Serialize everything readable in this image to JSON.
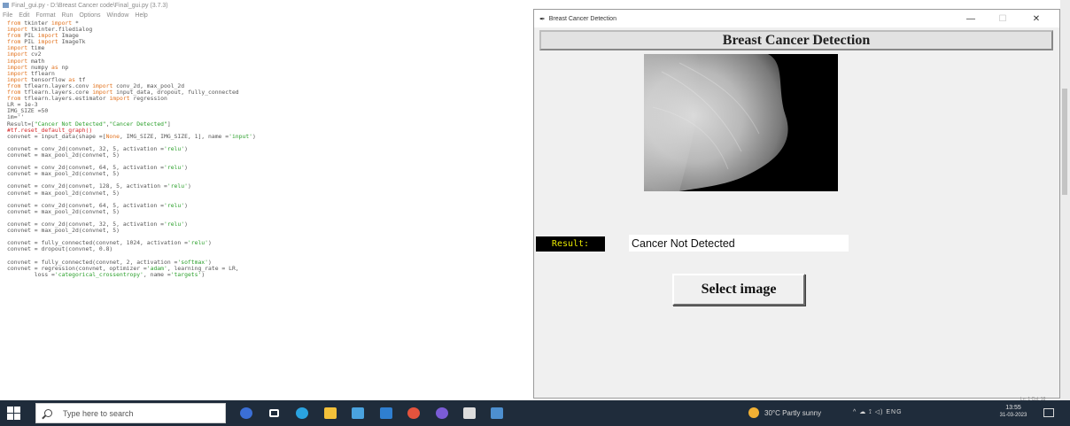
{
  "editor": {
    "title": "Final_gui.py - D:\\Breast Cancer code\\Final_gui.py (3.7.3)",
    "menu": [
      "File",
      "Edit",
      "Format",
      "Run",
      "Options",
      "Window",
      "Help"
    ],
    "code_lines": [
      [
        [
          "kw",
          "from "
        ],
        [
          "t",
          "tkinter "
        ],
        [
          "kw",
          "import "
        ],
        [
          "t",
          "*"
        ]
      ],
      [
        [
          "kw",
          "import "
        ],
        [
          "t",
          "tkinter.filedialog"
        ]
      ],
      [
        [
          "kw",
          "from "
        ],
        [
          "t",
          "PIL "
        ],
        [
          "kw",
          "import "
        ],
        [
          "t",
          "Image"
        ]
      ],
      [
        [
          "kw",
          "from "
        ],
        [
          "t",
          "PIL "
        ],
        [
          "kw",
          "import "
        ],
        [
          "t",
          "ImageTk"
        ]
      ],
      [
        [
          "kw",
          "import "
        ],
        [
          "t",
          "time"
        ]
      ],
      [
        [
          "kw",
          "import "
        ],
        [
          "t",
          "cv2"
        ]
      ],
      [
        [
          "kw",
          "import "
        ],
        [
          "t",
          "math"
        ]
      ],
      [
        [
          "kw",
          "import "
        ],
        [
          "t",
          "numpy "
        ],
        [
          "kw",
          "as "
        ],
        [
          "t",
          "np"
        ]
      ],
      [
        [
          "kw",
          "import "
        ],
        [
          "t",
          "tflearn"
        ]
      ],
      [
        [
          "kw",
          "import "
        ],
        [
          "t",
          "tensorflow "
        ],
        [
          "kw",
          "as "
        ],
        [
          "t",
          "tf"
        ]
      ],
      [
        [
          "kw",
          "from "
        ],
        [
          "t",
          "tflearn.layers.conv "
        ],
        [
          "kw",
          "import "
        ],
        [
          "t",
          "conv_2d, max_pool_2d"
        ]
      ],
      [
        [
          "kw",
          "from "
        ],
        [
          "t",
          "tflearn.layers.core "
        ],
        [
          "kw",
          "import "
        ],
        [
          "t",
          "input_data, dropout, fully_connected"
        ]
      ],
      [
        [
          "kw",
          "from "
        ],
        [
          "t",
          "tflearn.layers.estimator "
        ],
        [
          "kw",
          "import "
        ],
        [
          "t",
          "regression"
        ]
      ],
      [
        [
          "t",
          "LR = 1e-3"
        ]
      ],
      [
        [
          "t",
          "IMG_SIZE =50"
        ]
      ],
      [
        [
          "t",
          "im=''"
        ]
      ],
      [
        [
          "t",
          "Result=["
        ],
        [
          "str",
          "\"Cancer Not Detected\""
        ],
        [
          "t",
          ","
        ],
        [
          "str",
          "\"Cancer Detected\""
        ],
        [
          "t",
          "]"
        ]
      ],
      [
        [
          "cmt",
          "#tf.reset_default_graph()"
        ]
      ],
      [
        [
          "t",
          "convnet = input_data(shape =["
        ],
        [
          "kw",
          "None"
        ],
        [
          "t",
          ", IMG_SIZE, IMG_SIZE, 1], name ="
        ],
        [
          "str",
          "'input'"
        ],
        [
          "t",
          ")"
        ]
      ],
      [],
      [
        [
          "t",
          "convnet = conv_2d(convnet, 32, 5, activation ="
        ],
        [
          "str",
          "'relu'"
        ],
        [
          "t",
          ")"
        ]
      ],
      [
        [
          "t",
          "convnet = max_pool_2d(convnet, 5)"
        ]
      ],
      [],
      [
        [
          "t",
          "convnet = conv_2d(convnet, 64, 5, activation ="
        ],
        [
          "str",
          "'relu'"
        ],
        [
          "t",
          ")"
        ]
      ],
      [
        [
          "t",
          "convnet = max_pool_2d(convnet, 5)"
        ]
      ],
      [],
      [
        [
          "t",
          "convnet = conv_2d(convnet, 128, 5, activation ="
        ],
        [
          "str",
          "'relu'"
        ],
        [
          "t",
          ")"
        ]
      ],
      [
        [
          "t",
          "convnet = max_pool_2d(convnet, 5)"
        ]
      ],
      [],
      [
        [
          "t",
          "convnet = conv_2d(convnet, 64, 5, activation ="
        ],
        [
          "str",
          "'relu'"
        ],
        [
          "t",
          ")"
        ]
      ],
      [
        [
          "t",
          "convnet = max_pool_2d(convnet, 5)"
        ]
      ],
      [],
      [
        [
          "t",
          "convnet = conv_2d(convnet, 32, 5, activation ="
        ],
        [
          "str",
          "'relu'"
        ],
        [
          "t",
          ")"
        ]
      ],
      [
        [
          "t",
          "convnet = max_pool_2d(convnet, 5)"
        ]
      ],
      [],
      [
        [
          "t",
          "convnet = fully_connected(convnet, 1024, activation ="
        ],
        [
          "str",
          "'relu'"
        ],
        [
          "t",
          ")"
        ]
      ],
      [
        [
          "t",
          "convnet = dropout(convnet, 0.8)"
        ]
      ],
      [],
      [
        [
          "t",
          "convnet = fully_connected(convnet, 2, activation ="
        ],
        [
          "str",
          "'softmax'"
        ],
        [
          "t",
          ")"
        ]
      ],
      [
        [
          "t",
          "convnet = regression(convnet, optimizer ="
        ],
        [
          "str",
          "'adam'"
        ],
        [
          "t",
          ", learning_rate = LR,"
        ]
      ],
      [
        [
          "t",
          "        loss ="
        ],
        [
          "str",
          "'categorical_crossentropy'"
        ],
        [
          "t",
          ", name ="
        ],
        [
          "str",
          "'targets'"
        ],
        [
          "t",
          ")"
        ]
      ]
    ],
    "status": "Ln: 1  Col: 18"
  },
  "app": {
    "window_title": "Breast Cancer Detection",
    "heading": "Breast Cancer Detection",
    "result_label": "Result:",
    "result_value": "Cancer Not Detected",
    "select_button": "Select image",
    "window_controls": {
      "minimize": "—",
      "maximize": "☐",
      "close": "✕"
    }
  },
  "taskbar": {
    "search_placeholder": "Type here to search",
    "apps": [
      {
        "name": "cortana",
        "color": "#3b6fd6"
      },
      {
        "name": "task-view",
        "color": "#ffffff"
      },
      {
        "name": "edge",
        "color": "#2aa3e0"
      },
      {
        "name": "file-explorer",
        "color": "#f3c13a"
      },
      {
        "name": "store",
        "color": "#4aa3df"
      },
      {
        "name": "mail",
        "color": "#2f7fd1"
      },
      {
        "name": "chrome",
        "color": "#e5533d"
      },
      {
        "name": "browser",
        "color": "#7b5cd6"
      },
      {
        "name": "settings",
        "color": "#dddddd"
      },
      {
        "name": "python-idle",
        "color": "#4d8fcf"
      }
    ],
    "weather": "30°C  Partly sunny",
    "tray": "^  ☁  ⟟  ◁)  ENG",
    "language": "",
    "clock_time": "13:55",
    "clock_date": "31-03-2023"
  },
  "colors": {
    "app_background": "#f0f0f0",
    "result_label_bg": "#000000",
    "result_label_fg": "#e8e800",
    "taskbar": "#1f2c3b"
  }
}
